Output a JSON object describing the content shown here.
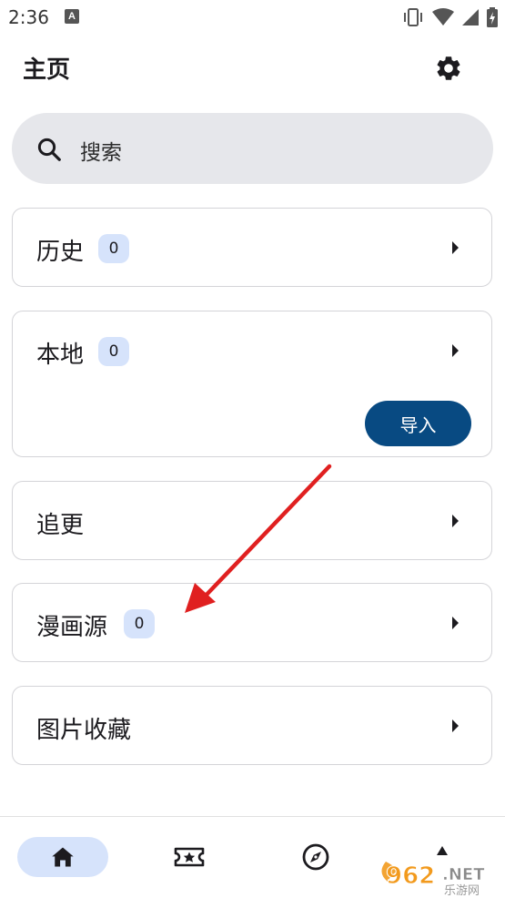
{
  "status_bar": {
    "time": "2:36",
    "notification_glyph": "A"
  },
  "header": {
    "title": "主页",
    "settings_icon": "gear-icon"
  },
  "search": {
    "label": "搜索",
    "icon": "search-icon"
  },
  "cards": {
    "history": {
      "label": "历史",
      "count": "0"
    },
    "local": {
      "label": "本地",
      "count": "0",
      "import_label": "导入"
    },
    "follow": {
      "label": "追更"
    },
    "comic_source": {
      "label": "漫画源",
      "count": "0"
    },
    "image_favorites": {
      "label": "图片收藏"
    }
  },
  "bottom_nav": {
    "items": [
      {
        "icon": "home-icon",
        "active": true
      },
      {
        "icon": "favorites-ticket-icon",
        "active": false
      },
      {
        "icon": "explore-compass-icon",
        "active": false
      },
      {
        "icon": "categories-icon",
        "active": false
      }
    ]
  },
  "watermark": {
    "brand": "962",
    "suffix": ".NET",
    "site": "乐游网"
  },
  "colors": {
    "accent": "#084a82",
    "badge_bg": "#d6e3fb",
    "search_bg": "#e6e7eb",
    "arrow": "#e02020"
  }
}
